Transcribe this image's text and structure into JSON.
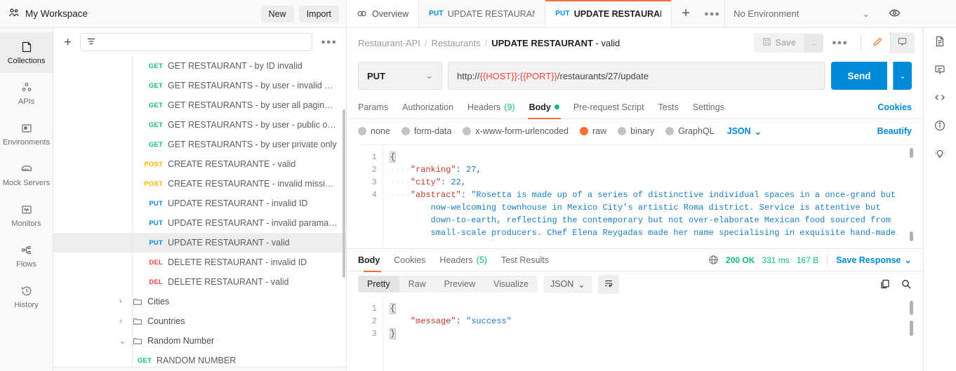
{
  "workspace": {
    "name": "My Workspace",
    "new_label": "New",
    "import_label": "Import",
    "icon": "users-icon"
  },
  "tabs": {
    "overview": {
      "label": "Overview",
      "icon": "overview-icon"
    },
    "items": [
      {
        "method": "PUT",
        "label": "UPDATE RESTAURANT - i",
        "active": false
      },
      {
        "method": "PUT",
        "label": "UPDATE RESTAURANT - v",
        "active": true
      }
    ],
    "plus": "+",
    "dots": "●●●"
  },
  "environment": {
    "selected": "No Environment",
    "chevron": "⌄"
  },
  "rail": [
    {
      "label": "Collections",
      "icon": "collections-icon",
      "active": true
    },
    {
      "label": "APIs",
      "icon": "apis-icon",
      "active": false
    },
    {
      "label": "Environments",
      "icon": "environments-icon",
      "active": false
    },
    {
      "label": "Mock Servers",
      "icon": "mock-servers-icon",
      "active": false
    },
    {
      "label": "Monitors",
      "icon": "monitors-icon",
      "active": false
    },
    {
      "label": "Flows",
      "icon": "flows-icon",
      "active": false
    },
    {
      "label": "History",
      "icon": "history-icon",
      "active": false
    }
  ],
  "sidebar": {
    "filter_placeholder": "",
    "plus": "+",
    "dots": "●●●",
    "rows": [
      {
        "kind": "request",
        "method": "GET",
        "label": "GET RESTAURANT - by ID invalid",
        "selected": false
      },
      {
        "kind": "request",
        "method": "GET",
        "label": "GET RESTAURANTS - by user - invalid parameters",
        "selected": false
      },
      {
        "kind": "request",
        "method": "GET",
        "label": "GET RESTAURANTS - by user all paginated",
        "selected": false
      },
      {
        "kind": "request",
        "method": "GET",
        "label": "GET RESTAURANTS - by user - public only",
        "selected": false
      },
      {
        "kind": "request",
        "method": "GET",
        "label": "GET RESTAURANTS - by user private only",
        "selected": false
      },
      {
        "kind": "request",
        "method": "POST",
        "label": "CREATE RESTAURANTE - valid",
        "selected": false
      },
      {
        "kind": "request",
        "method": "POST",
        "label": "CREATE RESTAURANTE - invalid missing parame...",
        "selected": false
      },
      {
        "kind": "request",
        "method": "PUT",
        "label": "UPDATE RESTAURANT - invalid ID",
        "selected": false
      },
      {
        "kind": "request",
        "method": "PUT",
        "label": "UPDATE RESTAURANT - invalid paramater",
        "selected": false
      },
      {
        "kind": "request",
        "method": "PUT",
        "label": "UPDATE RESTAURANT - valid",
        "selected": true
      },
      {
        "kind": "request",
        "method": "DEL",
        "label": "DELETE RESTAURANT - invalid ID",
        "selected": false
      },
      {
        "kind": "request",
        "method": "DEL",
        "label": "DELETE RESTAURANT - valid",
        "selected": false
      },
      {
        "kind": "folder",
        "chevron": "›",
        "label": "Cities",
        "selected": false
      },
      {
        "kind": "folder",
        "chevron": "›",
        "label": "Countries",
        "selected": false
      },
      {
        "kind": "folder",
        "chevron": "⌄",
        "label": "Random Number",
        "selected": false
      },
      {
        "kind": "request",
        "method": "GET",
        "label": "RANDOM NUMBER",
        "selected": false
      }
    ]
  },
  "request": {
    "breadcrumb": {
      "collection": "Restaurant-API",
      "folder": "Restaurants",
      "name_bold": "UPDATE RESTAURANT",
      "name_rest": " - valid",
      "sep": "/"
    },
    "save_label": "Save",
    "save_chevron": "⌄",
    "more_dots": "●●●",
    "method": "PUT",
    "method_chevron": "⌄",
    "url_prefix": "http://",
    "url_var_host": "{{HOST}}",
    "url_colon": ":",
    "url_var_port": "{{PORT}}",
    "url_suffix": "/restaurants/27/update",
    "send_label": "Send",
    "send_chevron": "⌄",
    "tabs": [
      {
        "label": "Params",
        "active": false
      },
      {
        "label": "Authorization",
        "active": false
      },
      {
        "label": "Headers",
        "count": "(9)",
        "active": false
      },
      {
        "label": "Body",
        "dot": true,
        "active": true
      },
      {
        "label": "Pre-request Script",
        "active": false
      },
      {
        "label": "Tests",
        "active": false
      },
      {
        "label": "Settings",
        "active": false
      }
    ],
    "cookies_label": "Cookies",
    "body_types": [
      {
        "label": "none",
        "on": false
      },
      {
        "label": "form-data",
        "on": false
      },
      {
        "label": "x-www-form-urlencoded",
        "on": false
      },
      {
        "label": "raw",
        "on": true
      },
      {
        "label": "binary",
        "on": false
      },
      {
        "label": "GraphQL",
        "on": false
      }
    ],
    "body_format": "JSON",
    "body_format_chevron": "⌄",
    "beautify_label": "Beautify",
    "body_line_numbers": [
      "1",
      "2",
      "3",
      "4"
    ],
    "body_json": {
      "ranking_key": "\"ranking\"",
      "ranking_val": "27",
      "city_key": "\"city\"",
      "city_val": "22",
      "abstract_key": "\"abstract\"",
      "abstract_line1": "\"Rosetta is made up of a series of distinctive individual spaces in a once-grand but",
      "abstract_line2": "now-welcoming townhouse in Mexico City’s artistic Roma district. Service is attentive but",
      "abstract_line3": "down-to-earth, reflecting the contemporary but not over-elaborate Mexican food sourced from",
      "abstract_line4": "small-scale producers. Chef Elena Reygadas made her name specialising in exquisite hand-made"
    }
  },
  "response": {
    "tabs": [
      {
        "label": "Body",
        "active": true
      },
      {
        "label": "Cookies",
        "active": false
      },
      {
        "label": "Headers",
        "count": "(5)",
        "active": false
      },
      {
        "label": "Test Results",
        "active": false
      }
    ],
    "status": "200 OK",
    "time": "331 ms",
    "size": "167 B",
    "save_response_label": "Save Response",
    "save_response_chevron": "⌄",
    "views": [
      {
        "label": "Pretty",
        "active": true
      },
      {
        "label": "Raw",
        "active": false
      },
      {
        "label": "Preview",
        "active": false
      },
      {
        "label": "Visualize",
        "active": false
      }
    ],
    "format": "JSON",
    "format_chevron": "⌄",
    "line_numbers": [
      "1",
      "2",
      "3"
    ],
    "json": {
      "open": "{",
      "message_key": "\"message\"",
      "message_val": "\"success\"",
      "close": "}"
    }
  },
  "right_rail": [
    {
      "icon": "document-icon"
    },
    {
      "icon": "comment-icon"
    },
    {
      "icon": "code-icon"
    },
    {
      "icon": "info-icon"
    },
    {
      "icon": "lightbulb-icon"
    }
  ],
  "colors": {
    "accent": "#ff6c37",
    "blue": "#0089d6",
    "green": "#10b981",
    "red": "#f0483e",
    "yellow": "#ffb400"
  }
}
